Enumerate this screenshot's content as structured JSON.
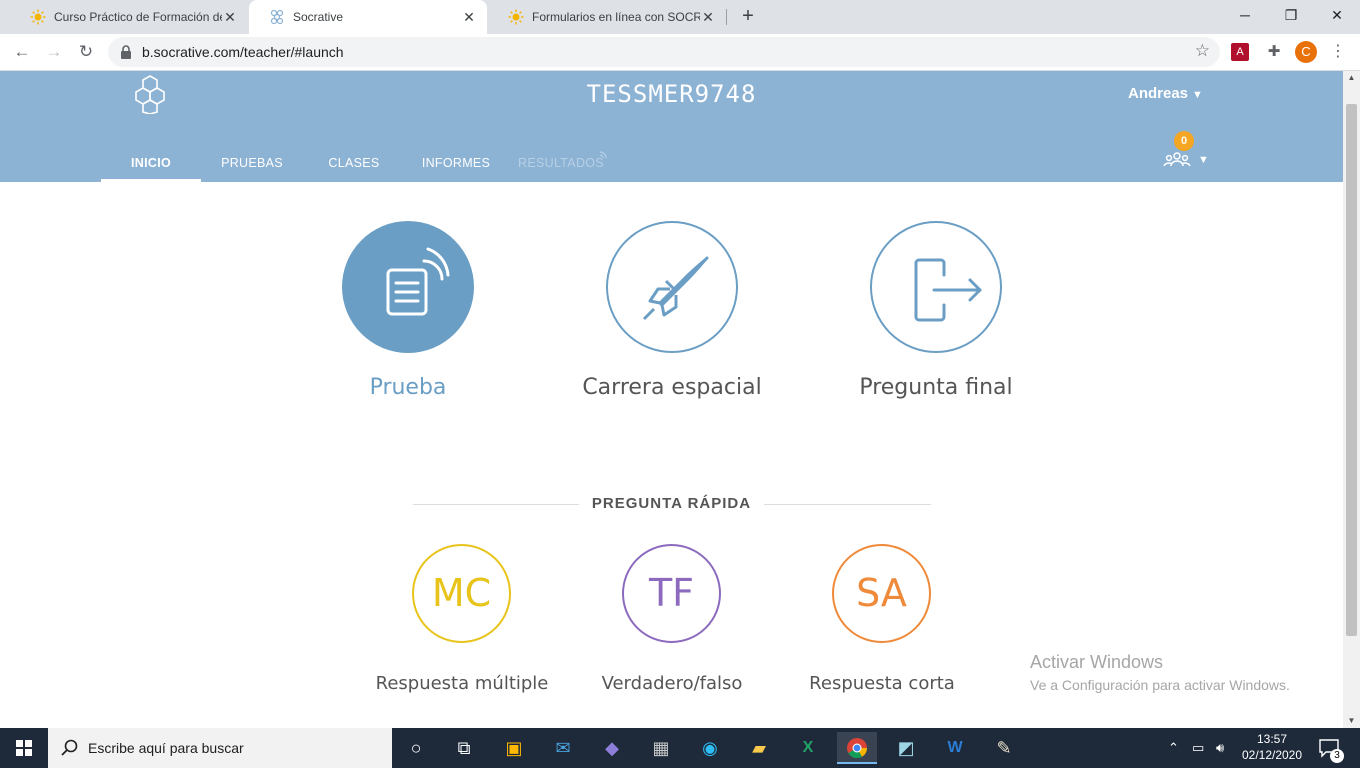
{
  "browser": {
    "tabs": [
      {
        "title": "Curso Práctico de Formación de E",
        "active": false
      },
      {
        "title": "Socrative",
        "active": true
      },
      {
        "title": "Formularios en línea con SOCRATI",
        "active": false
      }
    ],
    "url": "b.socrative.com/teacher/#launch",
    "profile_initial": "C"
  },
  "header": {
    "room_name": "TESSMER9748",
    "user_name": "Andreas",
    "student_count": "0",
    "nav": [
      "INICIO",
      "PRUEBAS",
      "CLASES",
      "INFORMES",
      "RESULTADOS"
    ]
  },
  "launch": {
    "items": [
      {
        "label": "Prueba",
        "icon": "quiz-icon"
      },
      {
        "label": "Carrera espacial",
        "icon": "rocket-icon"
      },
      {
        "label": "Pregunta final",
        "icon": "exit-ticket-icon"
      }
    ]
  },
  "quick_question": {
    "title": "PREGUNTA RÁPIDA",
    "items": [
      {
        "abbr": "MC",
        "label": "Respuesta múltiple",
        "color": "#e8c31a"
      },
      {
        "abbr": "TF",
        "label": "Verdadero/falso",
        "color": "#8c6bbf"
      },
      {
        "abbr": "SA",
        "label": "Respuesta corta",
        "color": "#ee8a3a"
      }
    ]
  },
  "watermark": {
    "title": "Activar Windows",
    "subtitle": "Ve a Configuración para activar Windows."
  },
  "taskbar": {
    "search_placeholder": "Escribe aquí para buscar",
    "time": "13:57",
    "date": "02/12/2020",
    "notification_count": "3"
  },
  "colors": {
    "header_bg": "#8cb2d4",
    "accent": "#6b9ec4"
  }
}
